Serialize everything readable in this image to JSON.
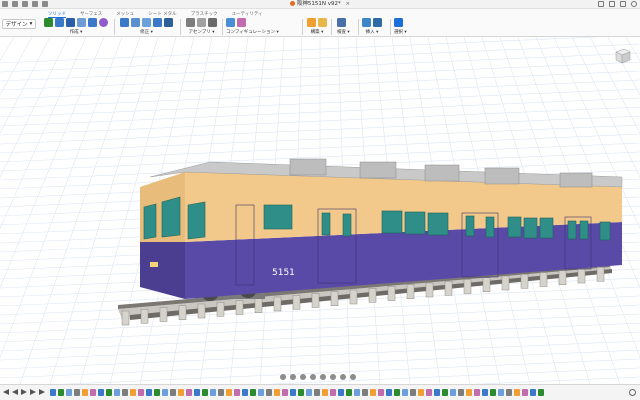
{
  "app": {
    "document_title": "阪神5151N v92*"
  },
  "workspace": {
    "label": "デザイン"
  },
  "tabs": [
    {
      "label": "ソリッド",
      "active": true
    },
    {
      "label": "サーフェス",
      "active": false
    },
    {
      "label": "メッシュ",
      "active": false
    },
    {
      "label": "シート メタル",
      "active": false
    },
    {
      "label": "プラスチック",
      "active": false
    },
    {
      "label": "ユーティリティ",
      "active": false
    }
  ],
  "toolbar_groups": [
    {
      "label": "作成 ▾"
    },
    {
      "label": "修正 ▾"
    },
    {
      "label": "アセンブリ ▾"
    },
    {
      "label": "コンフィギュレーション ▾"
    },
    {
      "label": "構築 ▾"
    },
    {
      "label": "検査 ▾"
    },
    {
      "label": "挿入 ▾"
    },
    {
      "label": "選択 ▾"
    }
  ],
  "model": {
    "car_number": "5151"
  },
  "colors": {
    "body_cream": "#f2c98a",
    "body_blue": "#5a4aa8",
    "roof_gray": "#c9c9c9",
    "window_glass": "#2f8f88",
    "accent": "#1b6fd8",
    "grid": "#dde6f2"
  },
  "icons": {
    "app_menu": "grid-icon",
    "file": "file-icon",
    "save": "save-icon",
    "undo": "undo-icon",
    "redo": "redo-icon",
    "close": "close-icon",
    "add": "plus-icon",
    "help": "help-icon",
    "notifications": "bell-icon",
    "profile": "user-icon"
  }
}
